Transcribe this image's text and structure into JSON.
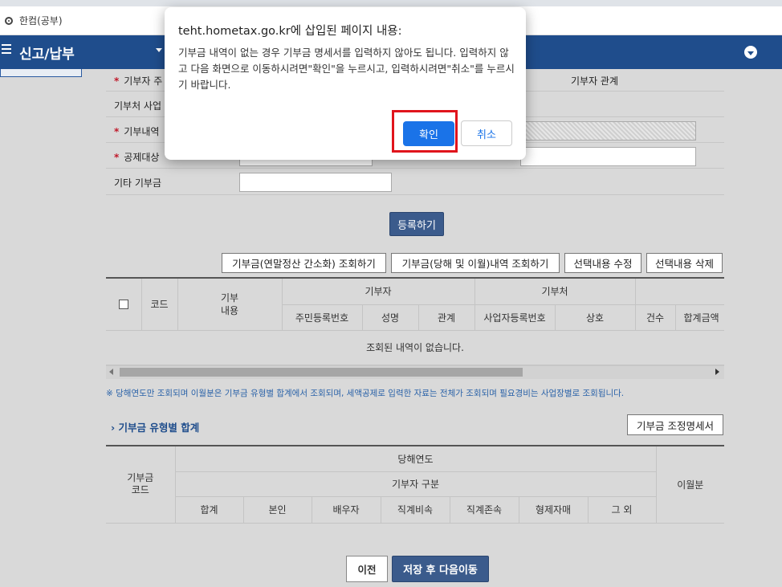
{
  "bookmark": {
    "label": "한컴(공부)",
    "icon": "target-icon"
  },
  "nav": {
    "title": "신고/납부",
    "bg_color": "#1f4d8c"
  },
  "form": {
    "donor_rrn_label": "기부자 주",
    "donor_relation_label": "기부자 관계",
    "recipient_bizno_label": "기부처 사업",
    "donation_detail_label": "기부내역",
    "deduction_label": "공제대상",
    "other_donation_label": "기타 기부금",
    "required_mark": "*"
  },
  "register_button": "등록하기",
  "action_buttons": [
    "기부금(연말정산 간소화) 조회하기",
    "기부금(당해 및 이월)내역 조회하기",
    "선택내용 수정",
    "선택내용 삭제"
  ],
  "table1": {
    "col_code": "코드",
    "col_content_1": "기부",
    "col_content_2": "내용",
    "group_donor": "기부자",
    "group_recipient": "기부처",
    "sub_cols": [
      "주민등록번호",
      "성명",
      "관계",
      "사업자등록번호",
      "상호",
      "건수",
      "합계금액"
    ],
    "empty_message": "조회된 내역이 없습니다."
  },
  "note": "※ 당해연도만 조회되며 이월분은 기부금 유형별 합계에서 조회되며, 세액공제로 입력한 자료는 전체가 조회되며 필요경비는 사업장별로 조회됩니다.",
  "section": {
    "title": "기부금 유형별 합계",
    "adjust_button": "기부금 조정명세서"
  },
  "table2": {
    "code_label_1": "기부금",
    "code_label_2": "코드",
    "current_year": "당해연도",
    "donor_type": "기부자 구분",
    "carryover": "이월분",
    "cols": [
      "합계",
      "본인",
      "배우자",
      "직계비속",
      "직계존속",
      "형제자매",
      "그 외"
    ]
  },
  "footer_buttons": {
    "prev": "이전",
    "save_next": "저장 후 다음이동"
  },
  "dialog": {
    "title": "teht.hometax.go.kr에 삽입된 페이지 내용:",
    "message": "기부금 내역이 없는 경우 기부금 명세서를 입력하지 않아도 됩니다. 입력하지 않고 다음 화면으로 이동하시려면\"확인\"을 누르시고, 입력하시려면\"취소\"를 누르시기 바랍니다.",
    "ok": "확인",
    "cancel": "취소",
    "ok_color": "#1a73e8",
    "highlight_color": "#e0141c"
  }
}
